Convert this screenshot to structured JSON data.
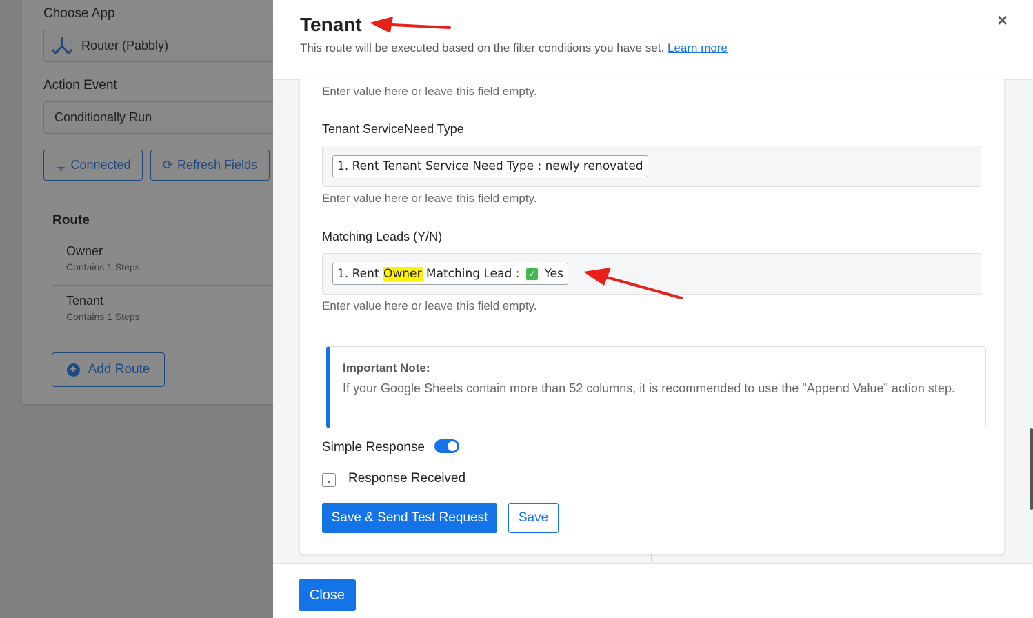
{
  "left_panel": {
    "choose_app_label": "Choose App",
    "app_name": "Router (Pabbly)",
    "action_event_label": "Action Event",
    "action_event_value": "Conditionally Run",
    "connected_label": "Connected",
    "refresh_label": "Refresh Fields",
    "route_heading": "Route",
    "routes": [
      {
        "name": "Owner",
        "steps": "Contains 1 Steps"
      },
      {
        "name": "Tenant",
        "steps": "Contains 1 Steps"
      }
    ],
    "add_route_label": "Add Route"
  },
  "modal": {
    "title": "Tenant",
    "subtitle": "This route will be executed based on the filter conditions you have set.",
    "learn_more": "Learn more",
    "close_x": "×",
    "hint": "Enter value here or leave this field empty.",
    "fields": [
      {
        "label": "Tenant ServiceNeed Type",
        "chip_text": "1. Rent Tenant Service Need Type : newly renovated"
      },
      {
        "label": "Matching Leads (Y/N)",
        "chip_prefix": "1. Rent ",
        "chip_highlight": "Owner",
        "chip_middle": " Matching Lead :",
        "chip_suffix": "Yes"
      }
    ],
    "note_title": "Important Note:",
    "note_text": "If your Google Sheets contain more than 52 columns, it is recommended to use the \"Append Value\" action step.",
    "simple_response_label": "Simple Response",
    "simple_response_on": true,
    "response_received_label": "Response Received",
    "save_send_label": "Save & Send Test Request",
    "save_label": "Save",
    "close_label": "Close"
  },
  "colors": {
    "primary": "#1473e6",
    "highlight": "#fff200",
    "annotation_arrow": "#e8201a",
    "overlay": "#808080"
  }
}
